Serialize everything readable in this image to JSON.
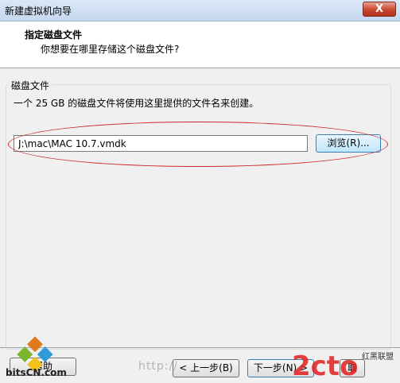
{
  "window": {
    "title": "新建虚拟机向导",
    "close_label": "X"
  },
  "header": {
    "title": "指定磁盘文件",
    "subtitle": "你想要在哪里存储这个磁盘文件?"
  },
  "disk_file": {
    "legend": "磁盘文件",
    "description": "一个 25 GB 的磁盘文件将使用这里提供的文件名来创建。",
    "path": "J:\\mac\\MAC 10.7.vmdk",
    "browse_label": "浏览(R)..."
  },
  "footer": {
    "help_label": "帮助",
    "back_label": "< 上一步(B)",
    "next_label": "下一步(N) >",
    "cancel_label": "取"
  },
  "watermarks": {
    "bitscn": "bitsCN.com",
    "url": "http://",
    "brand": "2cto",
    "brand_cn": "红黑联盟"
  },
  "colors": {
    "annotation": "#cc2a2a",
    "accent": "#3c7fb1"
  }
}
